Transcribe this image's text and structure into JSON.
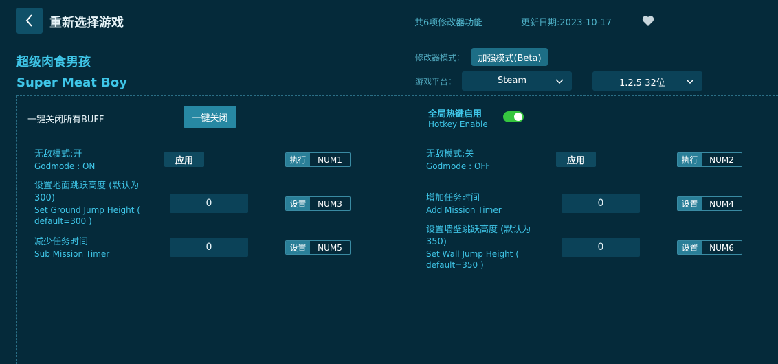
{
  "header": {
    "title": "重新选择游戏",
    "feature_count": "共6项修改器功能",
    "update_date": "更新日期:2023-10-17"
  },
  "game": {
    "name_cn": "超级肉食男孩",
    "name_en": "Super Meat Boy"
  },
  "settings": {
    "mode_label": "修改器模式：",
    "mode_value": "加强模式(Beta)",
    "platform_label": "游戏平台：",
    "platform_value": "Steam",
    "version_value": "1.2.5 32位"
  },
  "buff": {
    "label": "一键关闭所有BUFF",
    "button": "一键关闭"
  },
  "hotkey_toggle": {
    "title": "全局热键启用",
    "subtitle": "Hotkey Enable",
    "enabled": true
  },
  "options": {
    "godmode_on": {
      "cn": "无敌模式:开",
      "en": "Godmode : ON",
      "button": "应用",
      "action": "执行",
      "key": "NUM1"
    },
    "godmode_off": {
      "cn": "无敌模式:关",
      "en": "Godmode : OFF",
      "button": "应用",
      "action": "执行",
      "key": "NUM2"
    },
    "ground_jump": {
      "cn_line1": "设置地面跳跃高度 (默认为",
      "cn_line2": "300)",
      "en_line1": "Set Ground Jump Height (",
      "en_line2": "default=300 )",
      "value": "0",
      "action": "设置",
      "key": "NUM3"
    },
    "add_timer": {
      "cn": "增加任务时间",
      "en": "Add Mission Timer",
      "value": "0",
      "action": "设置",
      "key": "NUM4"
    },
    "sub_timer": {
      "cn": "减少任务时间",
      "en": "Sub Mission Timer",
      "value": "0",
      "action": "设置",
      "key": "NUM5"
    },
    "wall_jump": {
      "cn_line1": "设置墙壁跳跃高度 (默认为",
      "cn_line2": "350)",
      "en_line1": "Set Wall Jump Height (",
      "en_line2": "default=350 )",
      "value": "0",
      "action": "设置",
      "key": "NUM6"
    }
  },
  "icons": {
    "back": "chevron-left-icon",
    "favorite": "heart-icon",
    "dropdown": "chevron-down-icon"
  },
  "colors": {
    "background": "#052a3a",
    "accent": "#3fc6e8",
    "toggle_on": "#35c53f"
  }
}
